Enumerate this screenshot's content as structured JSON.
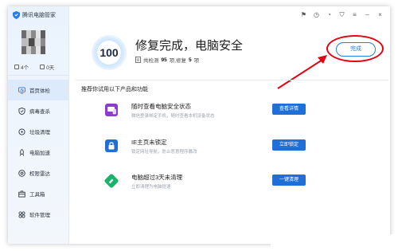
{
  "app": {
    "title": "腾讯电脑管家"
  },
  "user": {
    "stat_a": "4个",
    "stat_b": "0天"
  },
  "sidebar": {
    "items": [
      {
        "label": "首页体检",
        "icon": "monitor-icon",
        "active": true
      },
      {
        "label": "病毒查杀",
        "icon": "shield-icon",
        "active": false
      },
      {
        "label": "垃圾清理",
        "icon": "broom-icon",
        "active": false
      },
      {
        "label": "电脑加速",
        "icon": "rocket-icon",
        "active": false
      },
      {
        "label": "权限雷达",
        "icon": "radar-icon",
        "active": false
      },
      {
        "label": "工具箱",
        "icon": "toolbox-icon",
        "active": false
      },
      {
        "label": "软件管理",
        "icon": "apps-icon",
        "active": false
      }
    ]
  },
  "header": {
    "score": "100",
    "headline": "修复完成，电脑安全",
    "sub_prefix": "共检测",
    "checked_count": "95",
    "sub_middle": "项,修复",
    "fixed_count": "5",
    "sub_suffix": "项",
    "done_button": "完成"
  },
  "recommend": {
    "title": "推荐你试用以下产品和功能",
    "cards": [
      {
        "title": "随时查看电脑安全状态",
        "desc": "微信登录绑定手机，随时查看本机设备状态",
        "button": "查看详情",
        "icon": "phone-monitor-icon",
        "color": "#8b3bd1"
      },
      {
        "title": "IE主页未锁定",
        "desc": "锁定网址导航，防止恶意程序篡改",
        "button": "立即锁定",
        "icon": "lock-icon",
        "color": "#1f6fd6"
      },
      {
        "title": "电脑超过3天未清理",
        "desc": "立即清理为电脑提速",
        "button": "一键清理",
        "icon": "clean-icon",
        "color": "#19b36b"
      }
    ]
  },
  "colors": {
    "accent": "#1f6fd6",
    "annotation": "#e60012"
  }
}
